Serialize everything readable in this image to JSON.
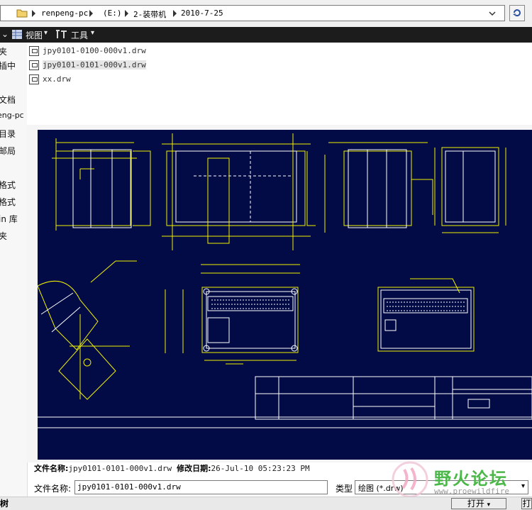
{
  "address": {
    "crumbs": [
      "renpeng-pc",
      "(E:)",
      "2-装带机",
      "2010-7-25"
    ]
  },
  "toolbar": {
    "view_label": "视图",
    "tools_label": "工具"
  },
  "nav": {
    "items": [
      "夹",
      "插中",
      "文档",
      "eng-pc",
      "目录",
      "邮局",
      "格式",
      "格式",
      "in 库",
      "夹"
    ]
  },
  "files": [
    {
      "name": "jpy0101-0100-000v1.drw",
      "selected": false
    },
    {
      "name": "jpy0101-0101-000v1.drw",
      "selected": true
    },
    {
      "name": "xx.drw",
      "selected": false
    }
  ],
  "info": {
    "name_label": "文件名称:",
    "name_value": "jpy0101-0101-000v1.drw",
    "date_label": "修改日期:",
    "date_value": "26-Jul-10 05:23:23 PM"
  },
  "form": {
    "filename_label": "文件名称:",
    "filename_value": "jpy0101-0101-000v1.drw",
    "type_label": "类型",
    "type_value": "绘图 (*.drw)"
  },
  "bottom": {
    "tree_label": "树",
    "open_label": "打开",
    "open2_label": "打"
  },
  "watermark": {
    "text": "野火论坛",
    "url": "www.proewildfire"
  },
  "colors": {
    "drawing_bg": "#020b45",
    "drawing_line": "#f2f200",
    "drawing_white": "#ffffff",
    "toolbar_bg": "#1c1c1c"
  }
}
